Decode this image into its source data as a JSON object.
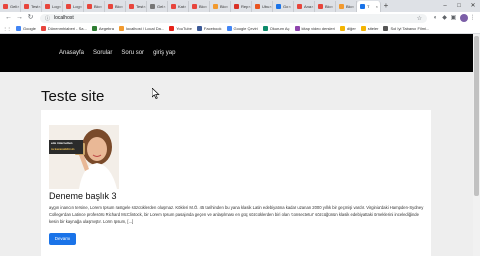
{
  "browser": {
    "tabs": [
      {
        "label": "Geli",
        "color": "#e8453c"
      },
      {
        "label": "Test",
        "color": "#e8453c"
      },
      {
        "label": "Log",
        "color": "#e8453c"
      },
      {
        "label": "Log",
        "color": "#e8453c"
      },
      {
        "label": "Blo",
        "color": "#e8453c"
      },
      {
        "label": "Blo",
        "color": "#e8453c"
      },
      {
        "label": "Test",
        "color": "#e8453c"
      },
      {
        "label": "Gel",
        "color": "#777777"
      },
      {
        "label": "Kat",
        "color": "#e8453c"
      },
      {
        "label": "Blo",
        "color": "#e8453c"
      },
      {
        "label": "Blo",
        "color": "#f29a2e"
      },
      {
        "label": "Rep",
        "color": "#d93025"
      },
      {
        "label": "Ubu",
        "color": "#e95420"
      },
      {
        "label": "Go",
        "color": "#1a73e8"
      },
      {
        "label": "Ana",
        "color": "#e8453c"
      },
      {
        "label": "Blo",
        "color": "#e8453c"
      },
      {
        "label": "Blo",
        "color": "#f29a2e"
      },
      {
        "label": "T",
        "color": "#1a73e8",
        "active": true
      }
    ],
    "new_tab": "+",
    "window_controls": {
      "minimize": "–",
      "maximize": "□",
      "close": "✕"
    },
    "url": "localhost",
    "bookmarks": [
      {
        "label": "Google",
        "color": "#4285f4"
      },
      {
        "label": "Dünenmhiaberi - Sa...",
        "color": "#e8453c"
      },
      {
        "label": "Aegebra",
        "color": "#2e7d32"
      },
      {
        "label": "localhost / Local Da...",
        "color": "#f29a2e"
      },
      {
        "label": "YouTube",
        "color": "#e62117"
      },
      {
        "label": "Facebook",
        "color": "#3b5998"
      },
      {
        "label": "Google Çeviri",
        "color": "#4285f4"
      },
      {
        "label": "Okurum Aç",
        "color": "#0d8a6a"
      },
      {
        "label": "kitap video dersleri",
        "color": "#8e44ad"
      },
      {
        "label": "diğer",
        "color": "#f4b400"
      },
      {
        "label": "siteler",
        "color": "#f4b400"
      },
      {
        "label": "Sol Iyi Tabancı Filmi...",
        "color": "#555555"
      }
    ]
  },
  "nav": {
    "items": [
      "Anasayfa",
      "Sorular",
      "Soru sor",
      "giriş yap"
    ]
  },
  "site": {
    "title": "Teste site"
  },
  "post": {
    "image_text_line1": "ede internetten",
    "image_text_line2": "ra kazanabilirsin",
    "title": "Deneme başlık 3",
    "excerpt": "aygın inancın tersine, Lorem Ipsum rastgele sözcüklerden oluşmaz. Kökleri M.Ö. 45 tarihinden bu yana klasik Latin edebiyatına kadar uzanan 2000 yıllık bir geçmişi vardır. Virginia'daki Hampden-Sydney College'dan Latince profesörü Richard McClintock, bir Lorem Ipsum pasajında geçen ve anlaşılması en güç sözcüklerden biri olan 'consectetur' sözcüğünün klasik edebiyattaki örneklerini incelediğinde kesin bir kaynağa ulaşmıştır. Lorm Ipsum, [...]",
    "button": "Devamı"
  }
}
